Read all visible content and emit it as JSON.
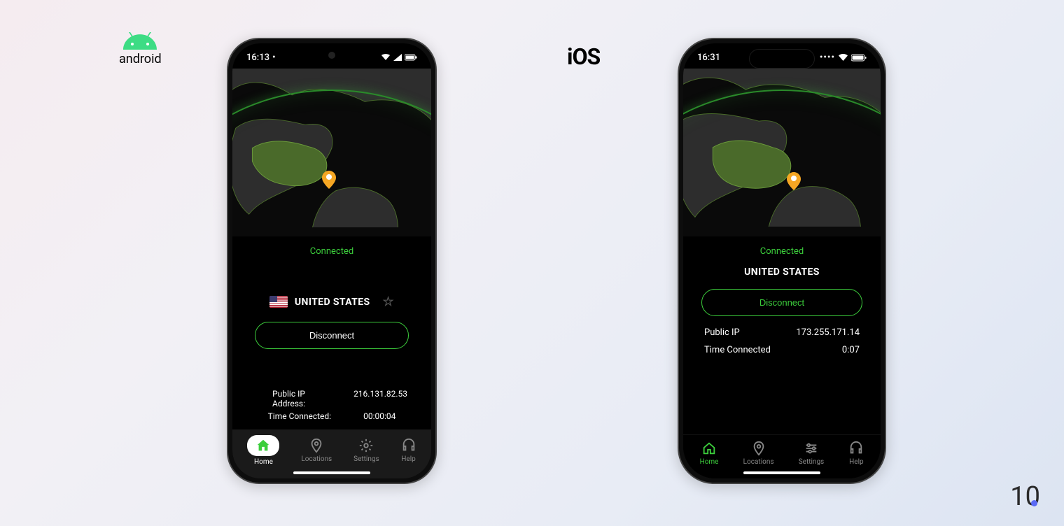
{
  "labels": {
    "android": "android",
    "ios": "iOS"
  },
  "android": {
    "time": "16:13",
    "status_text": "Connected",
    "country": "UNITED STATES",
    "disconnect": "Disconnect",
    "ip_label": "Public IP Address:",
    "ip_value": "216.131.82.53",
    "time_label": "Time Connected:",
    "time_value": "00:00:04",
    "tabs": {
      "home": "Home",
      "locations": "Locations",
      "settings": "Settings",
      "help": "Help"
    }
  },
  "ios": {
    "time": "16:31",
    "status_text": "Connected",
    "country": "UNITED STATES",
    "disconnect": "Disconnect",
    "ip_label": "Public IP",
    "ip_value": "173.255.171.14",
    "time_label": "Time Connected",
    "time_value": "0:07",
    "tabs": {
      "home": "Home",
      "locations": "Locations",
      "settings": "Settings",
      "help": "Help"
    }
  },
  "brand": {
    "one": "1",
    "zero": "0"
  }
}
